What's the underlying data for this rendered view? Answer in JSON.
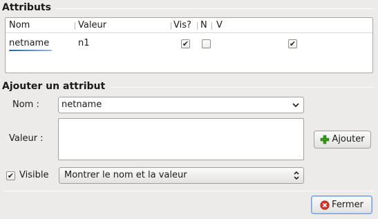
{
  "attributes_group": {
    "title": "Attributs",
    "columns": [
      "Nom",
      "Valeur",
      "Vis?",
      "N",
      "V"
    ],
    "rows": [
      {
        "name": "netname",
        "value": "n1",
        "visible": true,
        "show_name": false,
        "show_value": true
      }
    ]
  },
  "add_group": {
    "title": "Ajouter un attribut",
    "name_label": "Nom :",
    "name_value": "netname",
    "value_label": "Valeur :",
    "value_text": "",
    "add_button": "Ajouter",
    "visible_label": "Visible",
    "visible_checked": true,
    "display_select": "Montrer le nom et la valeur"
  },
  "close_button": "Fermer",
  "icons": {
    "dropdown": "chevron-down-icon",
    "spin": "updown-arrows-icon",
    "add": "plus-icon",
    "close": "close-circle-icon"
  },
  "colors": {
    "add_icon": "#3a9a1e",
    "close_icon": "#d0392b"
  }
}
